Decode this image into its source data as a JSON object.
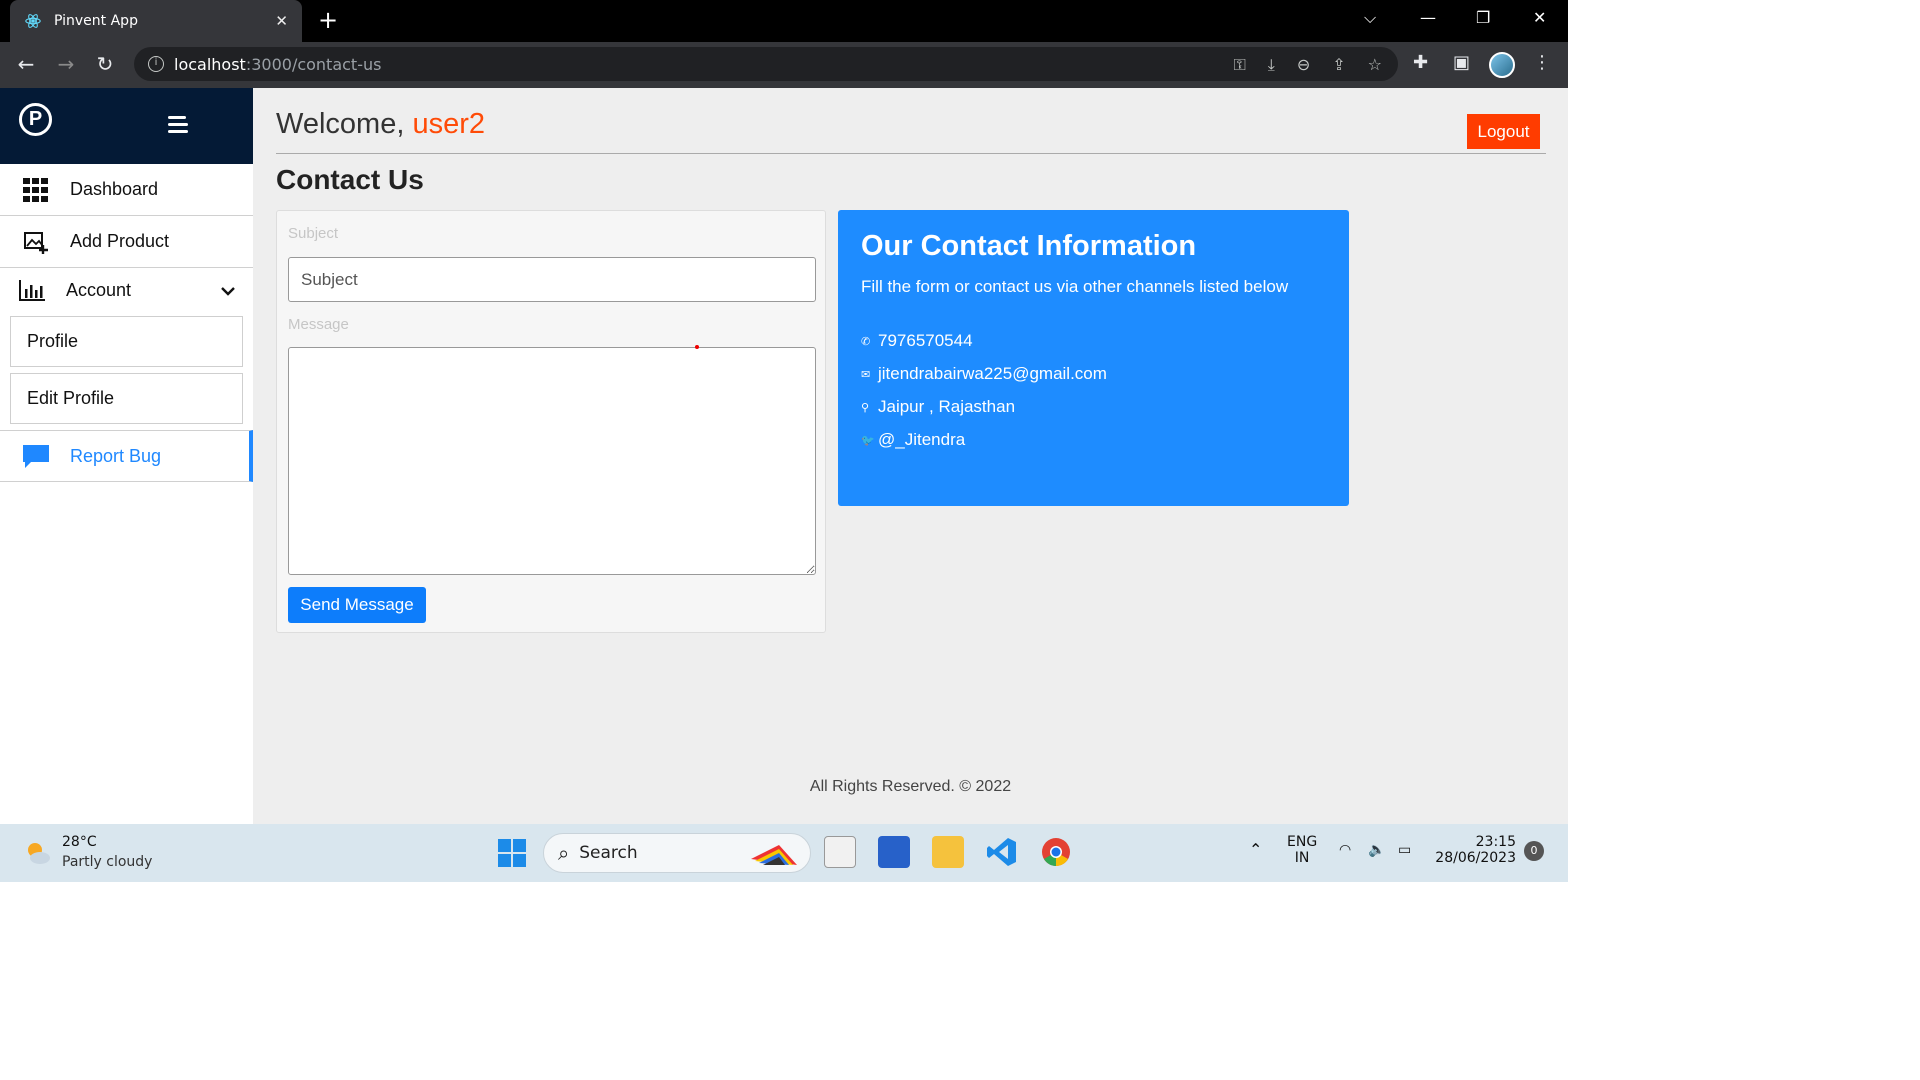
{
  "browser": {
    "tab_title": "Pinvent App",
    "url_host": "localhost",
    "url_path": ":3000/contact-us"
  },
  "sidebar": {
    "items": [
      {
        "label": "Dashboard"
      },
      {
        "label": "Add Product"
      },
      {
        "label": "Account"
      },
      {
        "label": "Profile"
      },
      {
        "label": "Edit Profile"
      },
      {
        "label": "Report Bug"
      }
    ]
  },
  "header": {
    "welcome": "Welcome,",
    "username": "user2",
    "logout": "Logout"
  },
  "page": {
    "title": "Contact Us"
  },
  "form": {
    "subject_label": "Subject",
    "subject_placeholder": "Subject",
    "message_label": "Message",
    "send_button": "Send Message"
  },
  "contact_info": {
    "title": "Our Contact Information",
    "subtitle": "Fill the form or contact us via other channels listed below",
    "phone": "7976570544",
    "email": "jitendrabairwa225@gmail.com",
    "location": "Jaipur , Rajasthan",
    "twitter": "@_Jitendra"
  },
  "footer": {
    "text": "All Rights Reserved. © 2022"
  },
  "taskbar": {
    "temperature": "28°C",
    "weather": "Partly cloudy",
    "search": "Search",
    "lang_top": "ENG",
    "lang_bottom": "IN",
    "time": "23:15",
    "date": "28/06/2023",
    "notifications": "0"
  },
  "colors": {
    "accent_orange": "#ff3c00",
    "accent_blue": "#1e8cff",
    "sidebar_dark": "#041a36"
  }
}
